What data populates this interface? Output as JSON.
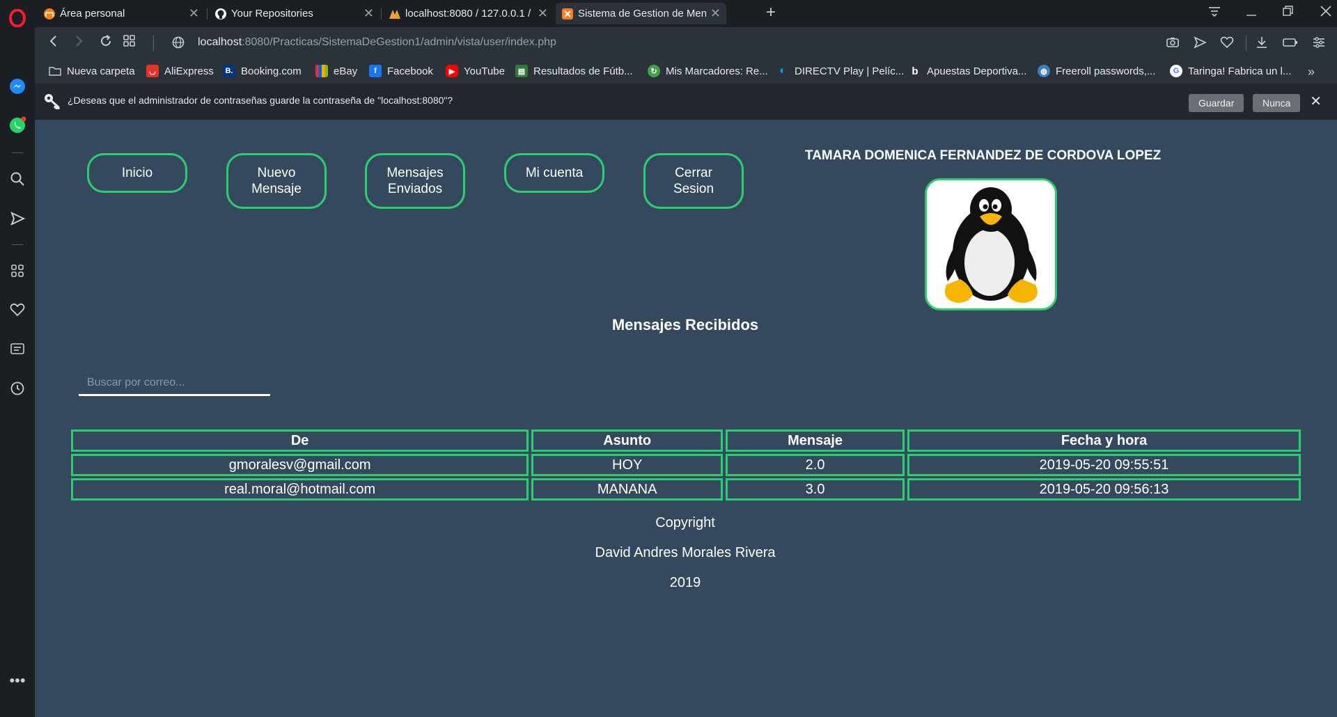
{
  "tabs": [
    {
      "title": "Área personal",
      "active": false
    },
    {
      "title": "Your Repositories",
      "active": false
    },
    {
      "title": "localhost:8080 / 127.0.0.1 /",
      "active": false
    },
    {
      "title": "Sistema de Gestion de Men",
      "active": true
    }
  ],
  "address": {
    "host": "localhost",
    "path": ":8080/Practicas/SistemaDeGestion1/admin/vista/user/index.php"
  },
  "bookmarks": [
    {
      "label": "Nueva carpeta",
      "icon": "folder-icon",
      "color": "#2c323a"
    },
    {
      "label": "AliExpress",
      "icon": "aliexpress-icon",
      "color": "#e43225"
    },
    {
      "label": "Booking.com",
      "icon": "booking-icon",
      "color": "#003580"
    },
    {
      "label": "eBay",
      "icon": "ebay-icon",
      "color": "#e53238"
    },
    {
      "label": "Facebook",
      "icon": "facebook-icon",
      "color": "#1877f2"
    },
    {
      "label": "YouTube",
      "icon": "youtube-icon",
      "color": "#ff0000"
    },
    {
      "label": "Resultados de Fútb...",
      "icon": "soccer-results-icon",
      "color": "#2e7d32"
    },
    {
      "label": "Mis Marcadores: Re...",
      "icon": "marcadores-icon",
      "color": "#43a047"
    },
    {
      "label": "DIRECTV Play | Pelíc...",
      "icon": "directv-icon",
      "color": "#00a6e6"
    },
    {
      "label": "Apuestas Deportiva...",
      "icon": "bwin-icon",
      "color": "#2c323a"
    },
    {
      "label": "Freeroll passwords,...",
      "icon": "globe-icon",
      "color": "#3f7fbf"
    },
    {
      "label": "Taringa! Fabrica un l...",
      "icon": "google-icon",
      "color": "#ffffff"
    }
  ],
  "password_bar": {
    "message": "¿Deseas que el administrador de contraseñas guarde la contraseña de \"localhost:8080\"?",
    "save_label": "Guardar",
    "never_label": "Nunca"
  },
  "nav": {
    "inicio": "Inicio",
    "nuevo_l1": "Nuevo",
    "nuevo_l2": "Mensaje",
    "enviados_l1": "Mensajes",
    "enviados_l2": "Enviados",
    "cuenta": "Mi cuenta",
    "cerrar_l1": "Cerrar",
    "cerrar_l2": "Sesion"
  },
  "user": {
    "name": "TAMARA DOMENICA FERNANDEZ DE CORDOVA LOPEZ"
  },
  "section_title": "Mensajes Recibidos",
  "search": {
    "placeholder": "Buscar por correo..."
  },
  "table": {
    "headers": [
      "De",
      "Asunto",
      "Mensaje",
      "Fecha y hora"
    ],
    "rows": [
      [
        "gmoralesv@gmail.com",
        "HOY",
        "2.0",
        "2019-05-20 09:55:51"
      ],
      [
        "real.moral@hotmail.com",
        "MANANA",
        "3.0",
        "2019-05-20 09:56:13"
      ]
    ]
  },
  "footer": {
    "line1": "Copyright",
    "line2": "David Andres Morales Rivera",
    "line3": "2019"
  },
  "colors": {
    "page_bg": "#34495e",
    "accent": "#2ecc71",
    "chrome": "#1b1f24"
  }
}
